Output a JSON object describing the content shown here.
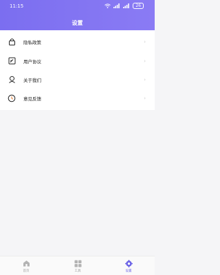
{
  "status": {
    "time": "11:15",
    "battery": "26"
  },
  "header": {
    "title": "设置"
  },
  "settings": {
    "items": [
      {
        "label": "隐私政策",
        "icon": "lock-icon",
        "chevron": "›"
      },
      {
        "label": "用户协议",
        "icon": "document-edit-icon",
        "chevron": "›"
      },
      {
        "label": "关于我们",
        "icon": "user-icon",
        "chevron": "›"
      },
      {
        "label": "意见反馈",
        "icon": "feedback-clock-icon",
        "chevron": "›"
      }
    ]
  },
  "tabbar": {
    "tabs": [
      {
        "label": "首页",
        "icon": "home-icon",
        "active": false
      },
      {
        "label": "工具",
        "icon": "tools-icon",
        "active": false
      },
      {
        "label": "设置",
        "icon": "settings-gear-icon",
        "active": true
      }
    ]
  },
  "colors": {
    "header": "#7b6ef0",
    "active_tab": "#6a62e6"
  }
}
